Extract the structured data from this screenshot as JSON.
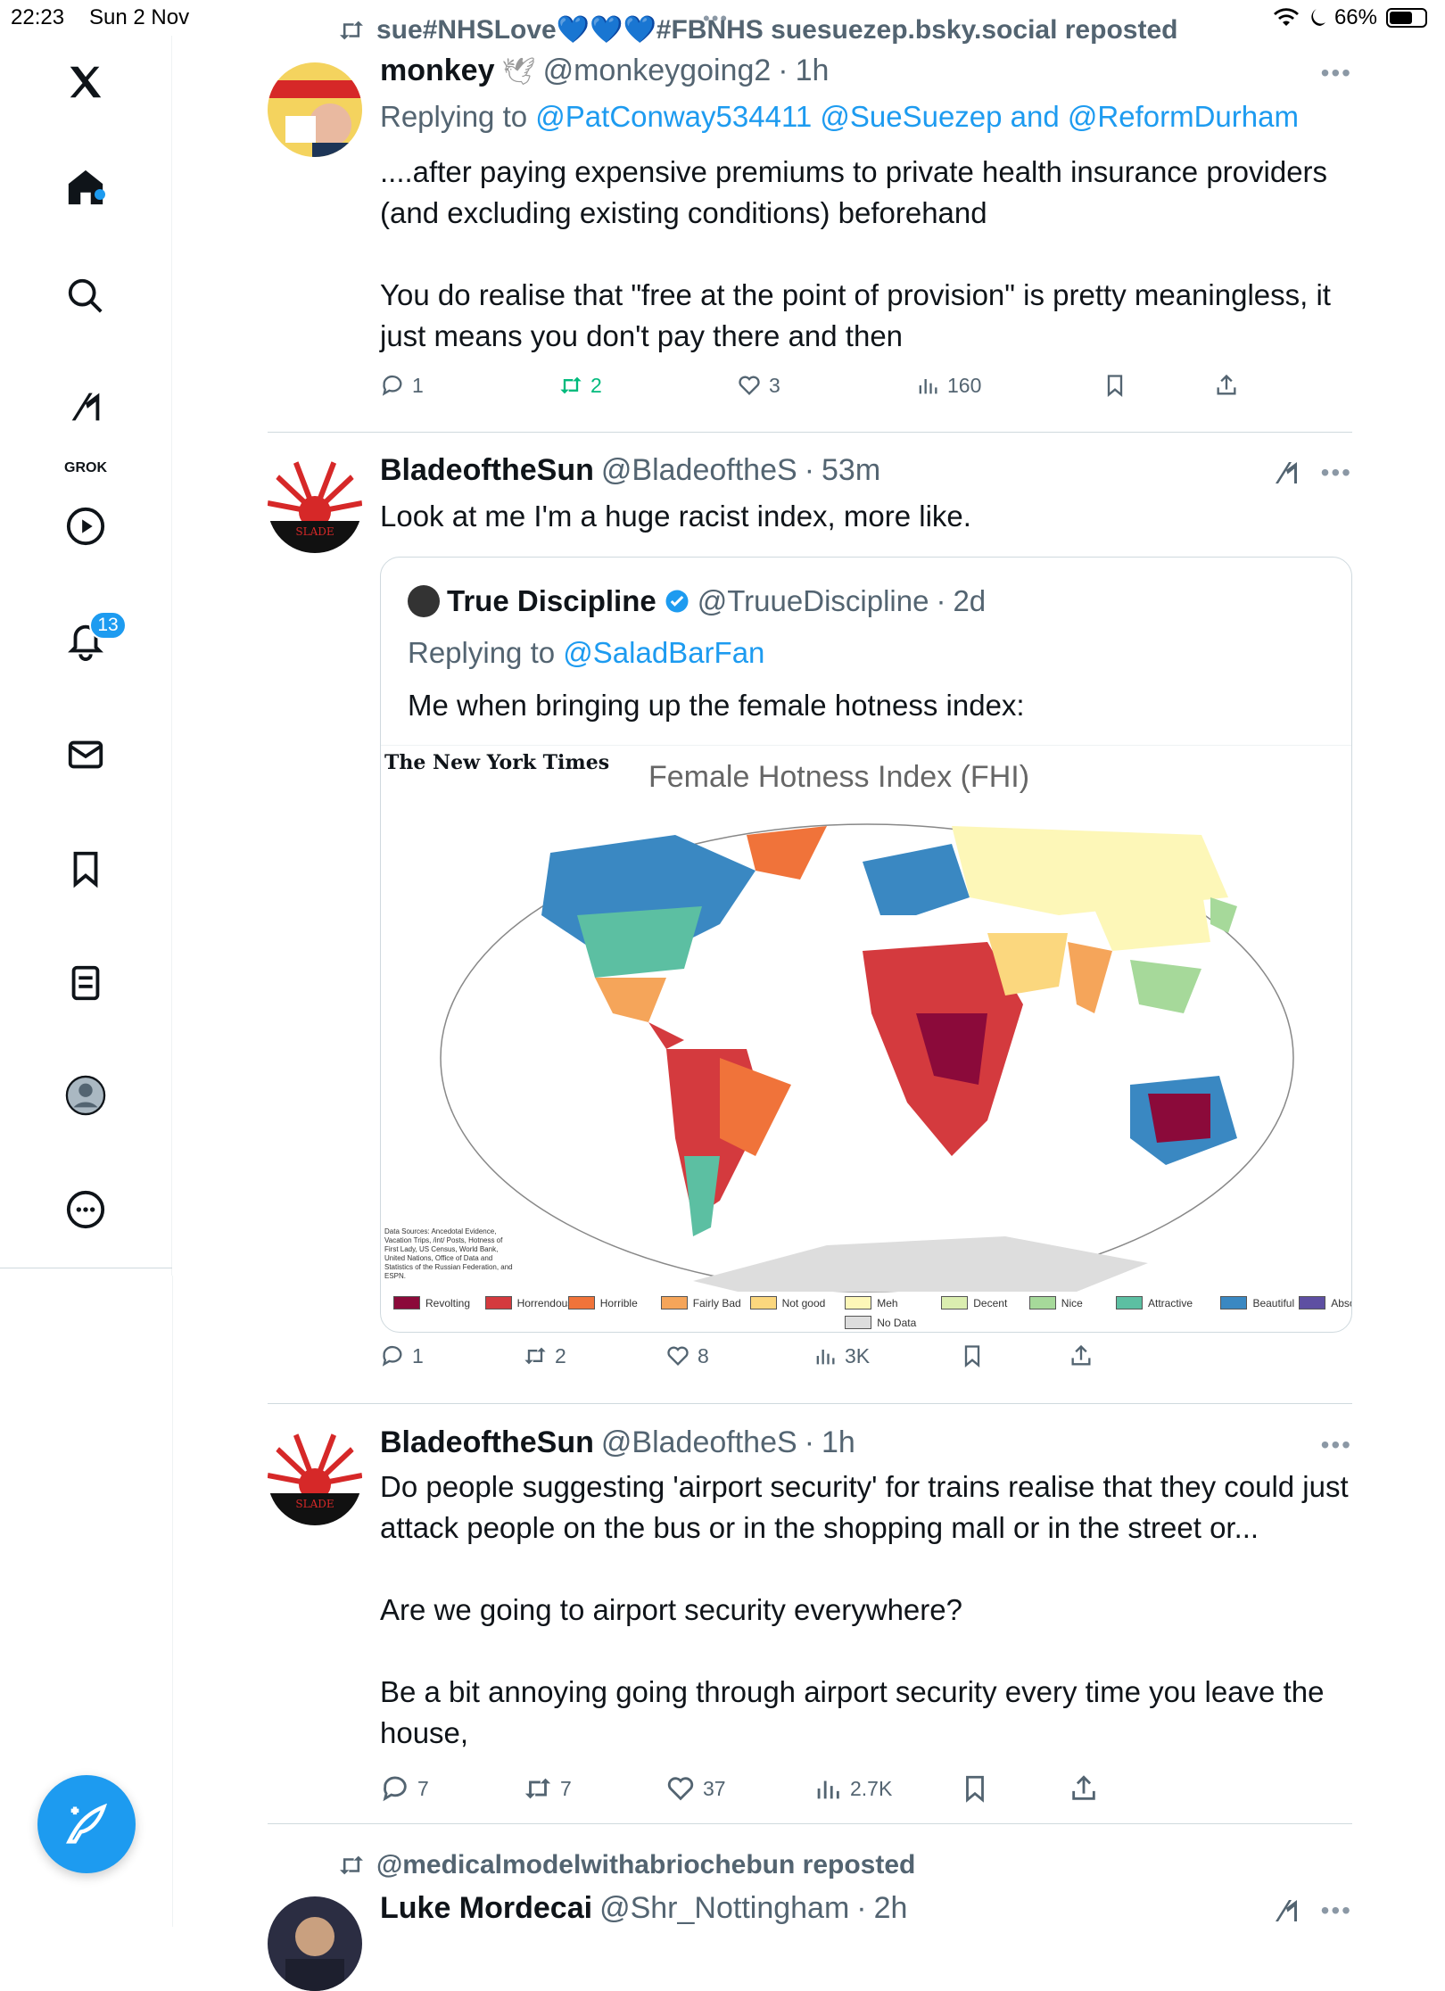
{
  "status_bar": {
    "time": "22:23",
    "date": "Sun 2 Nov",
    "battery": "66%",
    "battery_level": 0.66
  },
  "sidebar": {
    "items": [
      "X",
      "Home",
      "Search",
      "Grok",
      "Video",
      "Notifications",
      "Messages",
      "Bookmarks",
      "Lists",
      "Profile",
      "More"
    ],
    "grok_label": "GROK",
    "notifications_badge": "13"
  },
  "tweets": [
    {
      "repost_line": "sue#NHSLove💙💙💙#FBNHS suesuezep.bsky.social reposted",
      "name": "monkey",
      "handle": "@monkeygoing2",
      "time": "1h",
      "replying_prefix": "Replying to",
      "replying_links": "@PatConway534411 @SueSuezep and @ReformDurham",
      "body": "....after paying expensive premiums to private health insurance providers (and excluding existing conditions) beforehand\n\nYou do realise that \"free at the point of provision\" is pretty meaningless, it just means you don't pay there and then",
      "replies": "1",
      "reposts": "2",
      "likes": "3",
      "views": "160"
    },
    {
      "name": "BladeoftheSun",
      "handle": "@BladeoftheS",
      "time": "53m",
      "body": "Look at me I'm a huge racist index, more like.",
      "quote": {
        "name": "True Discipline",
        "handle": "@TruueDiscipline",
        "time": "2d",
        "replying_prefix": "Replying to",
        "replying_link": "@SaladBarFan",
        "body": "Me when bringing up the female hotness index:",
        "map": {
          "source_logo": "The New York Times",
          "title": "Female Hotness Index (FHI)",
          "sources": "Data Sources: Ancedotal Evidence, Vacation Trips, /int/ Posts, Hotness of First Lady, US Census, World Bank, United Nations, Office of Data and Statistics of the Russian Federation, and ESPN.",
          "legend": [
            {
              "label": "Revolting",
              "color": "#8b0a3a"
            },
            {
              "label": "Horrendous",
              "color": "#d43a3e"
            },
            {
              "label": "Horrible",
              "color": "#f0733a"
            },
            {
              "label": "Fairly Bad",
              "color": "#f5a55a"
            },
            {
              "label": "Not good",
              "color": "#fbd77e"
            },
            {
              "label": "Meh",
              "color": "#fdf7b8"
            },
            {
              "label": "Decent",
              "color": "#dbeeb0"
            },
            {
              "label": "Nice",
              "color": "#a6d99a"
            },
            {
              "label": "Attractive",
              "color": "#5cbfa2"
            },
            {
              "label": "Beautiful",
              "color": "#3a88c2"
            },
            {
              "label": "Absolute Perfection",
              "color": "#5e4fa2"
            },
            {
              "label": "No Data",
              "color": "#dddddd"
            }
          ]
        }
      },
      "replies": "1",
      "reposts": "2",
      "likes": "8",
      "views": "3K"
    },
    {
      "name": "BladeoftheSun",
      "handle": "@BladeoftheS",
      "time": "1h",
      "body": "Do people suggesting 'airport security' for trains realise that they could just attack people on the bus or in the shopping mall or in the street or...\n\nAre we going to airport security everywhere?\n\nBe a bit annoying going through airport security every time you leave the house,",
      "replies": "7",
      "reposts": "7",
      "likes": "37",
      "views": "2.7K"
    },
    {
      "repost_line": "@medicalmodelwithabriochebun reposted",
      "name": "Luke Mordecai",
      "handle": "@Shr_Nottingham",
      "time": "2h"
    }
  ],
  "colors": {
    "accent": "#1d9bf0",
    "text": "#0f1419",
    "muted": "#536471",
    "repost_green": "#00ba7c"
  }
}
